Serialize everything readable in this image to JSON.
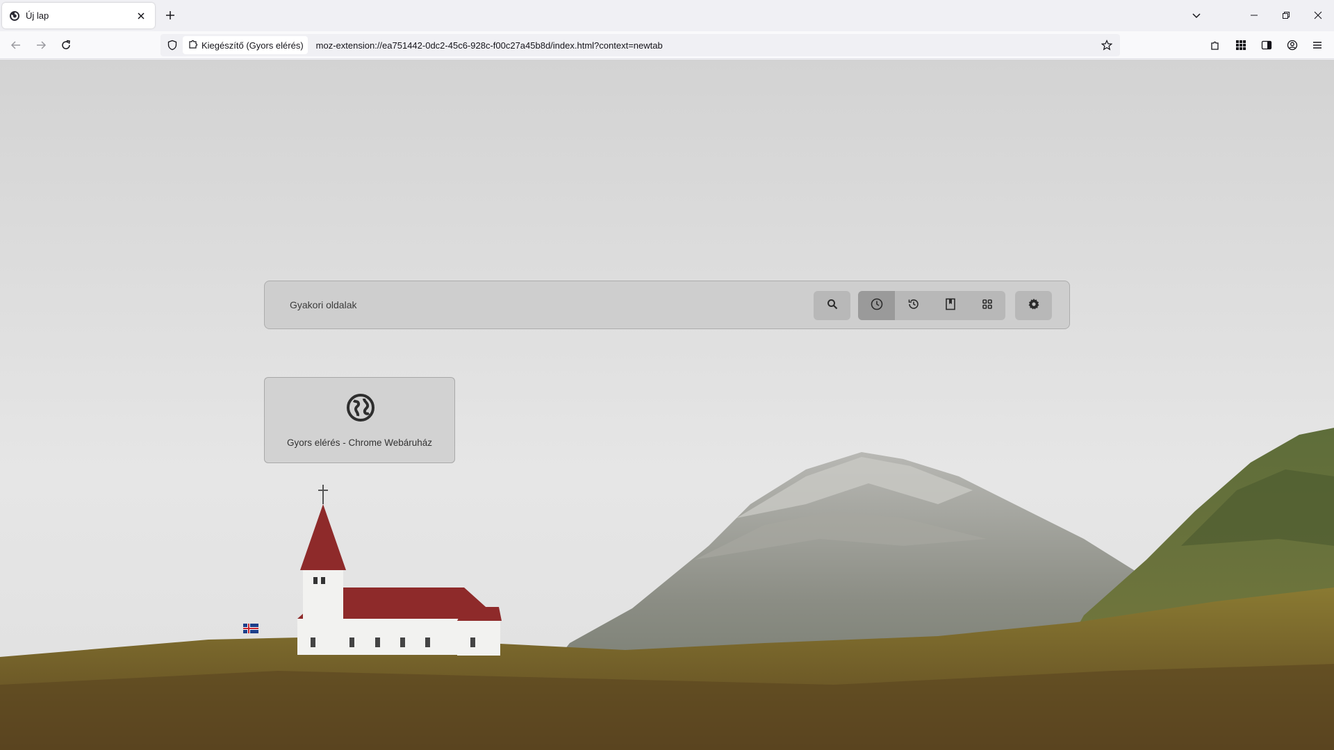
{
  "tab": {
    "title": "Új lap"
  },
  "urlbar": {
    "identity": "Kiegészítő (Gyors elérés)",
    "url": "moz-extension://ea751442-0dc2-45c6-928c-f00c27a45b8d/index.html?context=newtab"
  },
  "search": {
    "label": "Gyakori oldalak"
  },
  "toolbar_buttons": [
    {
      "icon": "search-icon"
    },
    {
      "icon": "clock-icon",
      "active": true
    },
    {
      "icon": "history-icon"
    },
    {
      "icon": "bookmark-icon"
    },
    {
      "icon": "grid-icon"
    },
    {
      "icon": "gear-icon"
    }
  ],
  "tiles": [
    {
      "label": "Gyors elérés - Chrome Webáruház",
      "icon": "globe-icon"
    }
  ],
  "colors": {
    "roof": "#8e2a2a",
    "sky": "#e4e4e4",
    "grass": "#7a6a2a"
  }
}
